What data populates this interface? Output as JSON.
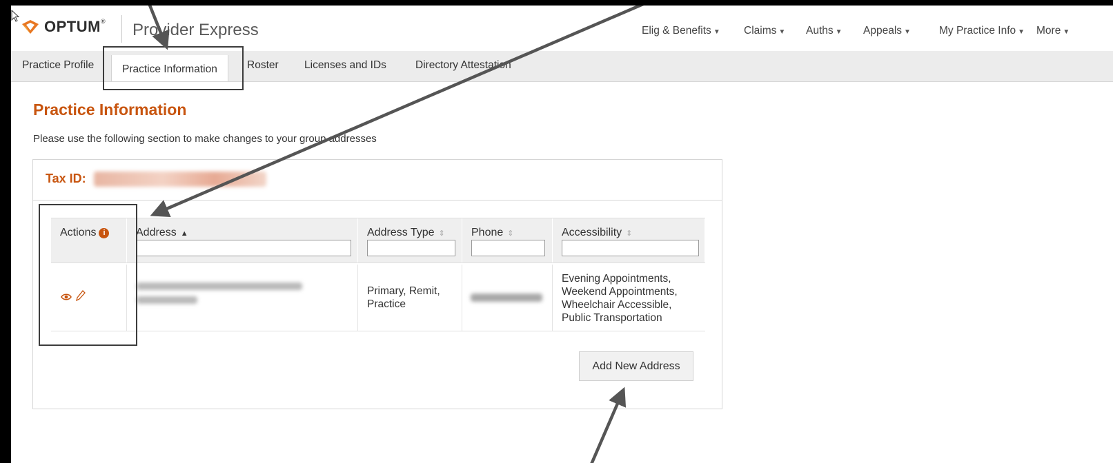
{
  "brand": {
    "logo_text": "OPTUM",
    "logo_reg": "®",
    "app_title": "Provider Express"
  },
  "nav": [
    {
      "label": "Elig & Benefits",
      "caret": "▼"
    },
    {
      "label": "Claims",
      "caret": "▼"
    },
    {
      "label": "Auths",
      "caret": "▼"
    },
    {
      "label": "Appeals",
      "caret": "▼"
    },
    {
      "label": "My Practice Info",
      "caret": "▼"
    },
    {
      "label": "More",
      "caret": "▼"
    }
  ],
  "tabs": [
    {
      "label": "Practice Profile",
      "active": false
    },
    {
      "label": "Practice Information",
      "active": true
    },
    {
      "label": "Roster",
      "active": false
    },
    {
      "label": "Licenses and IDs",
      "active": false
    },
    {
      "label": "Directory Attestation",
      "active": false
    }
  ],
  "page": {
    "title": "Practice Information",
    "intro": "Please use the following section to make changes to your group addresses"
  },
  "panel": {
    "tax_label": "Tax ID:"
  },
  "table": {
    "columns": [
      {
        "label": "Actions",
        "info": "i"
      },
      {
        "label": "Address",
        "sort": "▲"
      },
      {
        "label": "Address Type",
        "sort": "⇕"
      },
      {
        "label": "Phone",
        "sort": "⇕"
      },
      {
        "label": "Accessibility",
        "sort": "⇕"
      }
    ],
    "rows": [
      {
        "address_type_line1": "Primary, Remit,",
        "address_type_line2": "Practice",
        "accessibility": [
          "Evening Appointments,",
          "Weekend Appointments,",
          "Wheelchair Accessible,",
          "Public Transportation"
        ]
      }
    ]
  },
  "buttons": {
    "add_new_address": "Add New Address"
  },
  "colors": {
    "accent": "#c8550f",
    "frame": "#000000"
  }
}
